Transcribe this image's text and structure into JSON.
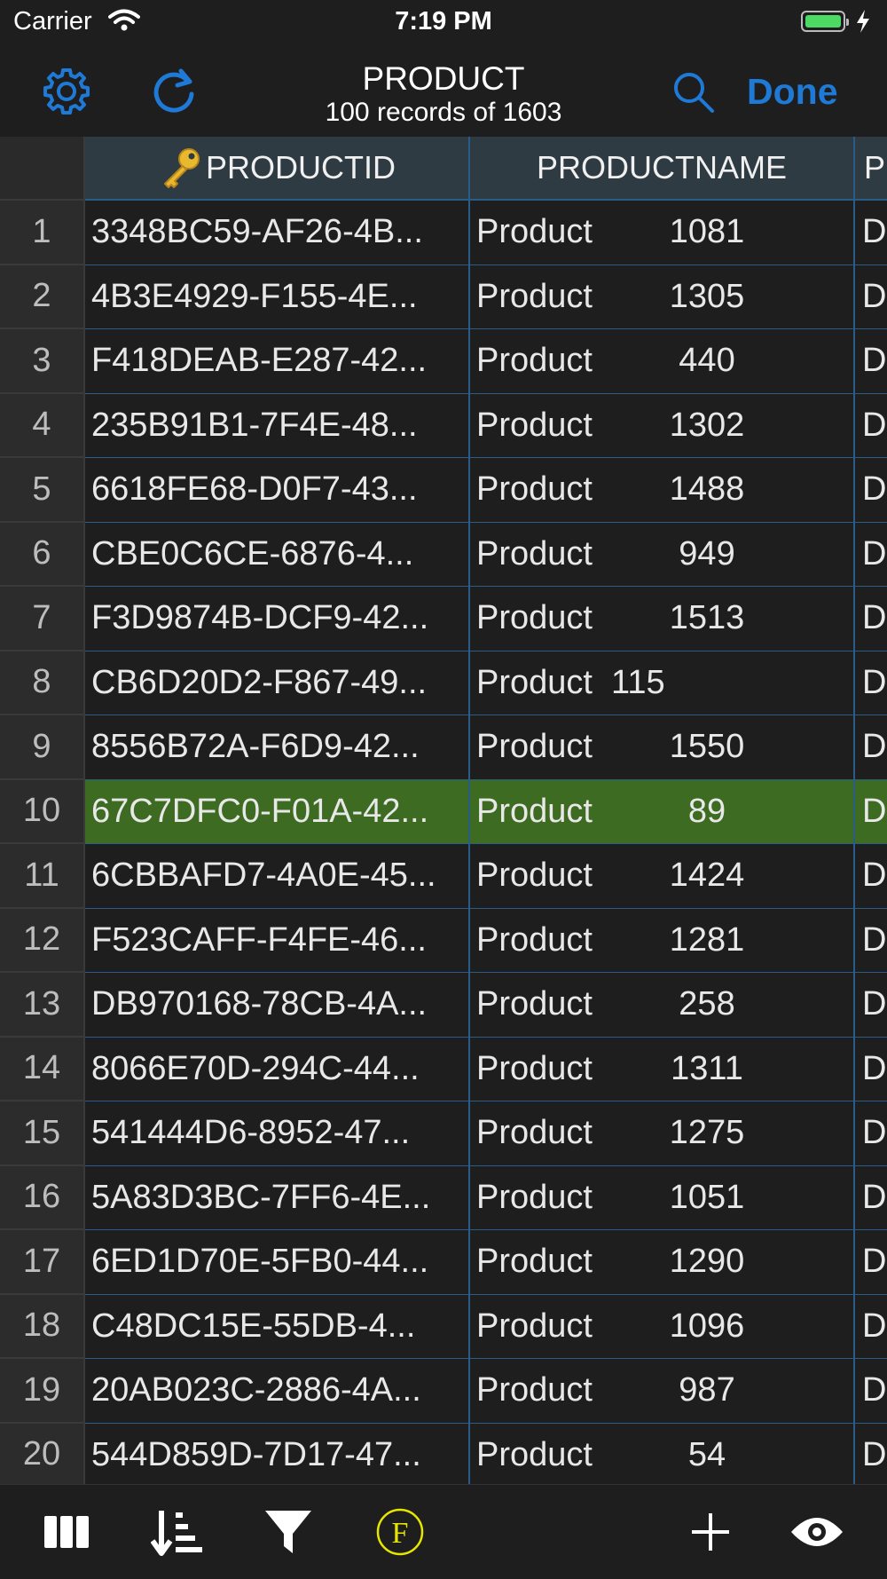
{
  "status": {
    "carrier": "Carrier",
    "time": "7:19 PM"
  },
  "nav": {
    "title": "PRODUCT",
    "subtitle": "100 records of 1603",
    "done_label": "Done"
  },
  "columns": {
    "id": "PRODUCTID",
    "name": "PRODUCTNAME",
    "extra": "P"
  },
  "rows": [
    {
      "n": "1",
      "id": "3348BC59-AF26-4B...",
      "name": "Product",
      "num": "1081",
      "extra": "D"
    },
    {
      "n": "2",
      "id": "4B3E4929-F155-4E...",
      "name": "Product",
      "num": "1305",
      "extra": "D"
    },
    {
      "n": "3",
      "id": "F418DEAB-E287-42...",
      "name": "Product",
      "num": "440",
      "extra": "D"
    },
    {
      "n": "4",
      "id": "235B91B1-7F4E-48...",
      "name": "Product",
      "num": "1302",
      "extra": "D"
    },
    {
      "n": "5",
      "id": "6618FE68-D0F7-43...",
      "name": "Product",
      "num": "1488",
      "extra": "D"
    },
    {
      "n": "6",
      "id": "CBE0C6CE-6876-4...",
      "name": "Product",
      "num": "949",
      "extra": "D"
    },
    {
      "n": "7",
      "id": "F3D9874B-DCF9-42...",
      "name": "Product",
      "num": "1513",
      "extra": "D"
    },
    {
      "n": "8",
      "id": "CB6D20D2-F867-49...",
      "name": "Product",
      "num": "115",
      "extra": "D"
    },
    {
      "n": "9",
      "id": "8556B72A-F6D9-42...",
      "name": "Product",
      "num": "1550",
      "extra": "D"
    },
    {
      "n": "10",
      "id": "67C7DFC0-F01A-42...",
      "name": "Product",
      "num": "89",
      "extra": "D"
    },
    {
      "n": "11",
      "id": "6CBBAFD7-4A0E-45...",
      "name": "Product",
      "num": "1424",
      "extra": "D"
    },
    {
      "n": "12",
      "id": "F523CAFF-F4FE-46...",
      "name": "Product",
      "num": "1281",
      "extra": "D"
    },
    {
      "n": "13",
      "id": "DB970168-78CB-4A...",
      "name": "Product",
      "num": "258",
      "extra": "D"
    },
    {
      "n": "14",
      "id": "8066E70D-294C-44...",
      "name": "Product",
      "num": "1311",
      "extra": "D"
    },
    {
      "n": "15",
      "id": "541444D6-8952-47...",
      "name": "Product",
      "num": "1275",
      "extra": "D"
    },
    {
      "n": "16",
      "id": "5A83D3BC-7FF6-4E...",
      "name": "Product",
      "num": "1051",
      "extra": "D"
    },
    {
      "n": "17",
      "id": "6ED1D70E-5FB0-44...",
      "name": "Product",
      "num": "1290",
      "extra": "D"
    },
    {
      "n": "18",
      "id": "C48DC15E-55DB-4...",
      "name": "Product",
      "num": "1096",
      "extra": "D"
    },
    {
      "n": "19",
      "id": "20AB023C-2886-4A...",
      "name": "Product",
      "num": "987",
      "extra": "D"
    },
    {
      "n": "20",
      "id": "544D859D-7D17-47...",
      "name": "Product",
      "num": "54",
      "extra": "D"
    }
  ],
  "selected_row": 10,
  "toolbar": {
    "formula_label": "F"
  },
  "colors": {
    "accent": "#1e7ad6",
    "selected_row": "#3d6b22",
    "header_bg": "#2e3b43",
    "grid_line": "#2a5c8a",
    "formula_yellow": "#e6e600"
  },
  "icons": [
    "gear-icon",
    "refresh-icon",
    "search-icon",
    "key-icon",
    "columns-icon",
    "sort-icon",
    "filter-icon",
    "formula-icon",
    "add-icon",
    "eye-icon"
  ]
}
